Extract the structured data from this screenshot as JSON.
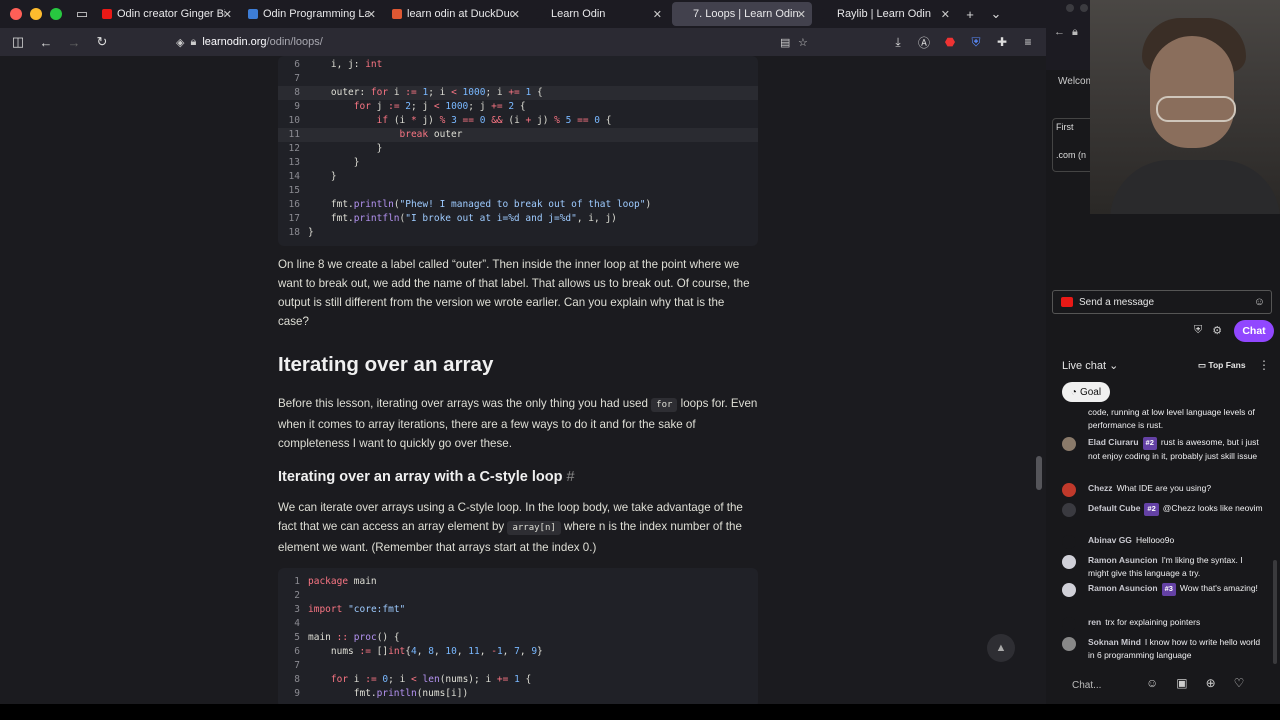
{
  "tabs": [
    {
      "label": "Odin creator Ginger Bill on hi",
      "fav_color": "#e91916",
      "active": false
    },
    {
      "label": "Odin Programming Language",
      "fav_color": "#3d7dd6",
      "active": false
    },
    {
      "label": "learn odin at DuckDuckGo",
      "fav_color": "#de5833",
      "active": false
    },
    {
      "label": "Learn Odin",
      "fav_color": "#1c1b22",
      "active": false
    },
    {
      "label": "7. Loops | Learn Odin",
      "fav_color": "#42414d",
      "active": true
    },
    {
      "label": "Raylib | Learn Odin",
      "fav_color": "#1c1b22",
      "active": false
    }
  ],
  "url": {
    "host": "learnodin.org",
    "path": "/odin/loops/"
  },
  "code1": [
    {
      "n": "6",
      "html": "    i, j: <span class='kw'>int</span>",
      "hl": false
    },
    {
      "n": "7",
      "html": "",
      "hl": false
    },
    {
      "n": "8",
      "html": "    outer: <span class='kw'>for</span> i <span class='kw'>:=</span> <span class='num'>1</span>; i <span class='kw'>&lt;</span> <span class='num'>1000</span>; i <span class='kw'>+=</span> <span class='num'>1</span> {",
      "hl": true
    },
    {
      "n": "9",
      "html": "        <span class='kw'>for</span> j <span class='kw'>:=</span> <span class='num'>2</span>; j <span class='kw'>&lt;</span> <span class='num'>1000</span>; j <span class='kw'>+=</span> <span class='num'>2</span> {",
      "hl": false
    },
    {
      "n": "10",
      "html": "            <span class='kw'>if</span> (i <span class='kw'>*</span> j) <span class='kw'>%</span> <span class='num'>3</span> <span class='kw'>==</span> <span class='num'>0</span> <span class='kw'>&amp;&amp;</span> (i <span class='kw'>+</span> j) <span class='kw'>%</span> <span class='num'>5</span> <span class='kw'>==</span> <span class='num'>0</span> {",
      "hl": false
    },
    {
      "n": "11",
      "html": "                <span class='kw'>break</span> outer",
      "hl": true
    },
    {
      "n": "12",
      "html": "            }",
      "hl": false
    },
    {
      "n": "13",
      "html": "        }",
      "hl": false
    },
    {
      "n": "14",
      "html": "    }",
      "hl": false
    },
    {
      "n": "15",
      "html": "",
      "hl": false
    },
    {
      "n": "16",
      "html": "    fmt.<span class='fn'>println</span>(<span class='str'>\"Phew! I managed to break out of that loop\"</span>)",
      "hl": false
    },
    {
      "n": "17",
      "html": "    fmt.<span class='fn'>printfln</span>(<span class='str'>\"I broke out at i=%d and j=%d\"</span>, i, j)",
      "hl": false
    },
    {
      "n": "18",
      "html": "}",
      "hl": false
    }
  ],
  "para1": "On line 8 we create a label called “outer”. Then inside the inner loop at the point where we want to break out, we add the name of that label. That allows us to break out. Of course, the output is still different from the version we wrote earlier. Can you explain why that is the case?",
  "h2": "Iterating over an array",
  "para2_a": "Before this lesson, iterating over arrays was the only thing you had used",
  "para2_code": "for",
  "para2_b": "loops for. Even when it comes to array iterations, there are a few ways to do it and for the sake of completeness I want to quickly go over these.",
  "h3": "Iterating over an array with a C-style loop",
  "h3_anchor": "#",
  "para3_a": "We can iterate over arrays using a C-style loop. In the loop body, we take advantage of the fact that we can access an array element by",
  "para3_code": "array[n]",
  "para3_b": "where n is the index number of the element we want. (Remember that arrays start at the index 0.)",
  "code2": [
    {
      "n": "1",
      "html": "<span class='kw'>package</span> main"
    },
    {
      "n": "2",
      "html": ""
    },
    {
      "n": "3",
      "html": "<span class='kw'>import</span> <span class='str'>\"core:fmt\"</span>"
    },
    {
      "n": "4",
      "html": ""
    },
    {
      "n": "5",
      "html": "main <span class='kw'>::</span> <span class='fn'>proc</span>() {"
    },
    {
      "n": "6",
      "html": "    nums <span class='kw'>:=</span> []<span class='kw'>int</span>{<span class='num'>4</span>, <span class='num'>8</span>, <span class='num'>10</span>, <span class='num'>11</span>, <span class='kw'>-</span><span class='num'>1</span>, <span class='num'>7</span>, <span class='num'>9</span>}"
    },
    {
      "n": "7",
      "html": ""
    },
    {
      "n": "8",
      "html": "    <span class='kw'>for</span> i <span class='kw'>:=</span> <span class='num'>0</span>; i <span class='kw'>&lt;</span> <span class='fn'>len</span>(nums); i <span class='kw'>+=</span> <span class='num'>1</span> {"
    },
    {
      "n": "9",
      "html": "        fmt.<span class='fn'>println</span>(nums[i])"
    }
  ],
  "sidebar": {
    "welcome": "Welcom",
    "first": "First",
    "com": ".com (n"
  },
  "chat": {
    "send_placeholder": "Send a message",
    "chat_button": "Chat",
    "live_chat": "Live chat",
    "top_fans": "Top Fans",
    "goal": "Goal",
    "input_placeholder": "Chat...",
    "messages": [
      {
        "user": "",
        "badge": "",
        "text": "code, running at low level language levels of performance is rust.",
        "avatar": ""
      },
      {
        "user": "Elad Ciuraru",
        "badge": "#2",
        "text": "rust is awesome, but i just not enjoy coding in it, probably just skill issue",
        "avatar": "#8a7a6a"
      },
      {
        "user": "Chezz",
        "badge": "",
        "text": "What IDE are you using?",
        "avatar": "#c0392b"
      },
      {
        "user": "Default Cube",
        "badge": "#2",
        "text": "@Chezz looks like neovim",
        "avatar": "#3a3a40"
      },
      {
        "user": "Abinav GG",
        "badge": "",
        "text": "Hellooo9o",
        "avatar": "#18181b"
      },
      {
        "user": "Ramon Asuncion",
        "badge": "",
        "text": "I'm liking the syntax. I might give this language a try.",
        "avatar": "#d0d0d8"
      },
      {
        "user": "Ramon Asuncion",
        "badge": "#3",
        "text": "Wow that's amazing!",
        "avatar": "#d0d0d8"
      },
      {
        "user": "ren",
        "badge": "",
        "text": "trx for explaining pointers",
        "avatar": "#18181b"
      },
      {
        "user": "Soknan Mind",
        "badge": "",
        "text": "I know how to write hello world in 6 programming language",
        "avatar": "#888"
      }
    ]
  }
}
